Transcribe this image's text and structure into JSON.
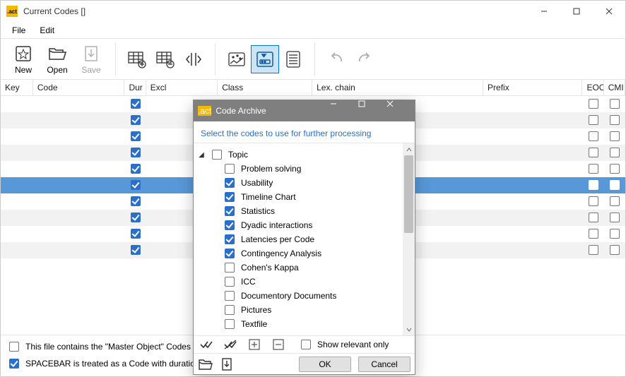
{
  "window": {
    "title": "Current Codes []",
    "app_icon_text": ".act"
  },
  "menu": {
    "file": "File",
    "edit": "Edit"
  },
  "toolbar": {
    "new": "New",
    "open": "Open",
    "save": "Save"
  },
  "columns": {
    "key": "Key",
    "code": "Code",
    "dur": "Dur",
    "excl": "Excl",
    "class": "Class",
    "lex": "Lex. chain",
    "prefix": "Prefix",
    "eoc": "EOC",
    "cmi": "CMI"
  },
  "rows": [
    {
      "dur": true,
      "eoc": false,
      "cmi": false
    },
    {
      "dur": true,
      "eoc": false,
      "cmi": false
    },
    {
      "dur": true,
      "eoc": false,
      "cmi": false
    },
    {
      "dur": true,
      "eoc": false,
      "cmi": false
    },
    {
      "dur": true,
      "eoc": false,
      "cmi": false
    },
    {
      "dur": true,
      "eoc": false,
      "cmi": false,
      "selected": true
    },
    {
      "dur": true,
      "eoc": false,
      "cmi": false
    },
    {
      "dur": true,
      "eoc": false,
      "cmi": false
    },
    {
      "dur": true,
      "eoc": false,
      "cmi": false
    },
    {
      "dur": true,
      "eoc": false,
      "cmi": false
    }
  ],
  "footer": {
    "master": "This file contains the \"Master Object\" Codes",
    "spacebar": "SPACEBAR is treated as a Code with duration",
    "master_checked": false,
    "spacebar_checked": true
  },
  "dialog": {
    "title": "Code Archive",
    "hint": "Select the codes to use for further processing",
    "root_label": "Topic",
    "root_checked": false,
    "items": [
      {
        "label": "Problem solving",
        "checked": false
      },
      {
        "label": "Usability",
        "checked": true
      },
      {
        "label": "Timeline Chart",
        "checked": true
      },
      {
        "label": "Statistics",
        "checked": true
      },
      {
        "label": "Dyadic interactions",
        "checked": true
      },
      {
        "label": "Latencies per Code",
        "checked": true
      },
      {
        "label": "Contingency Analysis",
        "checked": true
      },
      {
        "label": "Cohen's Kappa",
        "checked": false
      },
      {
        "label": "ICC",
        "checked": false
      },
      {
        "label": "Documentory Documents",
        "checked": false
      },
      {
        "label": "Pictures",
        "checked": false
      },
      {
        "label": "Textfile",
        "checked": false
      }
    ],
    "show_relevant": "Show relevant only",
    "show_relevant_checked": false,
    "ok": "OK",
    "cancel": "Cancel"
  }
}
